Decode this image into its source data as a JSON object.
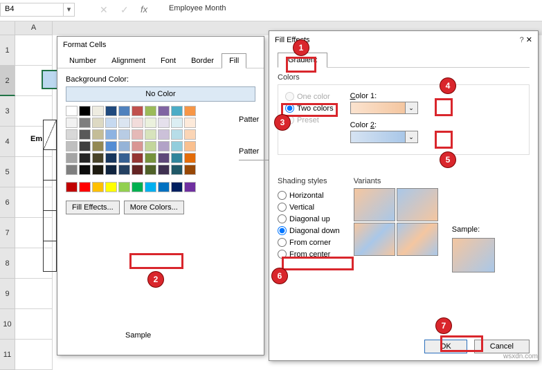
{
  "formula_bar": {
    "cell_ref": "B4",
    "value": "Employee Month"
  },
  "columns": [
    "A"
  ],
  "rows_visible": [
    "1",
    "2",
    "3",
    "4",
    "5",
    "6",
    "7",
    "8",
    "9",
    "10",
    "11"
  ],
  "sheet_fragment": {
    "label": "Em"
  },
  "format_cells": {
    "title": "Format Cells",
    "tabs": [
      "Number",
      "Alignment",
      "Font",
      "Border",
      "Fill"
    ],
    "active_tab": "Fill",
    "bg_label": "Background Color:",
    "no_color": "No Color",
    "fill_effects_btn": "Fill Effects...",
    "more_colors_btn": "More Colors...",
    "pattern_color_label": "Patter",
    "pattern_style_label": "Patter",
    "sample_label": "Sample",
    "palette_colors": [
      "#ffffff",
      "#000000",
      "#eeece1",
      "#1f497d",
      "#4f81bd",
      "#c0504d",
      "#9bbb59",
      "#8064a2",
      "#4bacc6",
      "#f79646",
      "#f2f2f2",
      "#7f7f7f",
      "#ddd9c3",
      "#c6d9f0",
      "#dbe5f1",
      "#f2dcdb",
      "#ebf1dd",
      "#e5e0ec",
      "#dbeef3",
      "#fdeada",
      "#d8d8d8",
      "#595959",
      "#c4bd97",
      "#8db3e2",
      "#b8cce4",
      "#e5b9b7",
      "#d7e3bc",
      "#ccc1d9",
      "#b7dde8",
      "#fbd5b5",
      "#bfbfbf",
      "#3f3f3f",
      "#938953",
      "#548dd4",
      "#95b3d7",
      "#d99694",
      "#c3d69b",
      "#b2a2c7",
      "#92cddc",
      "#fac08f",
      "#a5a5a5",
      "#262626",
      "#494429",
      "#17365d",
      "#366092",
      "#953734",
      "#76923c",
      "#5f497a",
      "#31859b",
      "#e36c09",
      "#7f7f7f",
      "#0c0c0c",
      "#1d1b10",
      "#0f243e",
      "#244061",
      "#632423",
      "#4f6128",
      "#3f3151",
      "#205867",
      "#974806"
    ],
    "standard_colors": [
      "#c00000",
      "#ff0000",
      "#ffc000",
      "#ffff00",
      "#92d050",
      "#00b050",
      "#00b0f0",
      "#0070c0",
      "#002060",
      "#7030a0"
    ]
  },
  "fill_effects": {
    "title": "Fill Effects",
    "tab": "Gradient",
    "colors_label": "Colors",
    "color_options": {
      "one": "One color",
      "two": "Two colors",
      "preset": "Preset"
    },
    "color1_label": "Color 1:",
    "color2_label": "Color 2:",
    "color1_value": "#f4c6a0",
    "color2_value": "#a9c7e8",
    "shading_label": "Shading styles",
    "shading_options": [
      "Horizontal",
      "Vertical",
      "Diagonal up",
      "Diagonal down",
      "From corner",
      "From center"
    ],
    "variants_label": "Variants",
    "sample_label": "Sample:",
    "ok": "OK",
    "cancel": "Cancel"
  },
  "callouts": [
    "1",
    "2",
    "3",
    "4",
    "5",
    "6",
    "7"
  ],
  "watermark": "wsxdn.com"
}
